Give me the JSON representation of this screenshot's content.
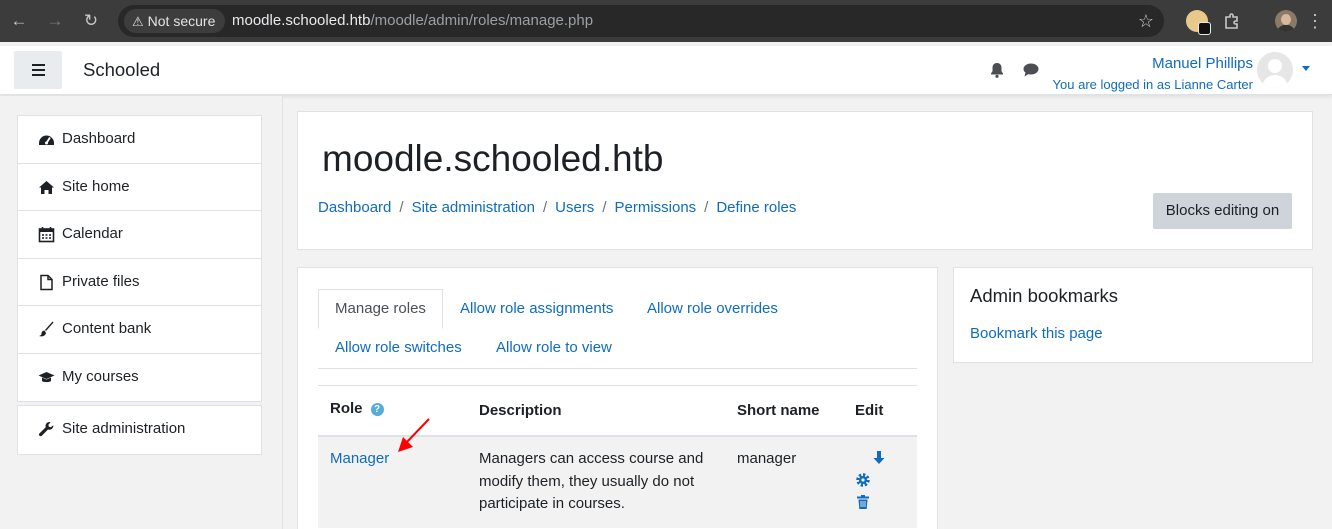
{
  "browser": {
    "security_label": "Not secure",
    "url_host": "moodle.schooled.htb",
    "url_path": "/moodle/admin/roles/manage.php"
  },
  "navbar": {
    "brand": "Schooled",
    "user_name": "Manuel Phillips",
    "logged_in_as": "You are logged in as Lianne Carter"
  },
  "sidebar": {
    "items": [
      {
        "label": "Dashboard",
        "icon": "dashboard-icon"
      },
      {
        "label": "Site home",
        "icon": "home-icon"
      },
      {
        "label": "Calendar",
        "icon": "calendar-icon"
      },
      {
        "label": "Private files",
        "icon": "file-icon"
      },
      {
        "label": "Content bank",
        "icon": "paintbrush-icon"
      },
      {
        "label": "My courses",
        "icon": "graduation-cap-icon"
      }
    ],
    "admin_item": {
      "label": "Site administration",
      "icon": "wrench-icon"
    }
  },
  "header": {
    "site_title": "moodle.schooled.htb",
    "breadcrumb": [
      "Dashboard",
      "Site administration",
      "Users",
      "Permissions",
      "Define roles"
    ],
    "separator": "/",
    "blocks_editing_label": "Blocks editing on"
  },
  "tabs": [
    {
      "label": "Manage roles",
      "active": true
    },
    {
      "label": "Allow role assignments",
      "active": false
    },
    {
      "label": "Allow role overrides",
      "active": false
    },
    {
      "label": "Allow role switches",
      "active": false
    },
    {
      "label": "Allow role to view",
      "active": false
    }
  ],
  "roles_table": {
    "headers": [
      "Role",
      "Description",
      "Short name",
      "Edit"
    ],
    "rows": [
      {
        "role": "Manager",
        "description": "Managers can access course and modify them, they usually do not participate in courses.",
        "short_name": "manager",
        "edit_icons": [
          "arrow-down-icon",
          "gear-icon",
          "trash-icon"
        ]
      }
    ]
  },
  "admin_bookmarks": {
    "title": "Admin bookmarks",
    "link": "Bookmark this page"
  },
  "colors": {
    "link": "#0f6cbf",
    "text": "#1d2125",
    "annotation_arrow": "#ff0000"
  }
}
